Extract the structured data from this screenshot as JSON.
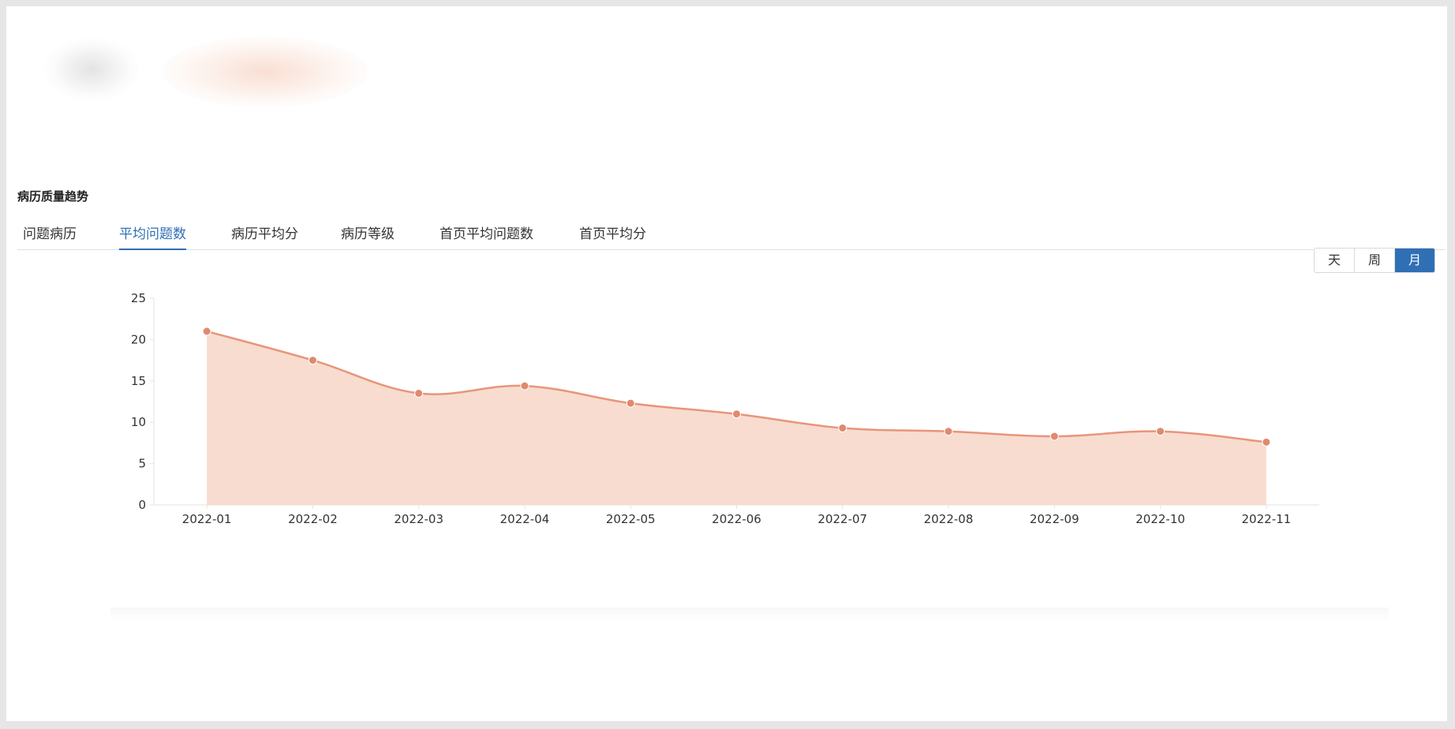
{
  "section_title": "病历质量趋势",
  "tabs": [
    {
      "label": "问题病历",
      "active": false
    },
    {
      "label": "平均问题数",
      "active": true
    },
    {
      "label": "病历平均分",
      "active": false
    },
    {
      "label": "病历等级",
      "active": false
    },
    {
      "label": "首页平均问题数",
      "active": false
    },
    {
      "label": "首页平均分",
      "active": false
    }
  ],
  "period_buttons": [
    {
      "label": "天",
      "active": false
    },
    {
      "label": "周",
      "active": false
    },
    {
      "label": "月",
      "active": true
    }
  ],
  "colors": {
    "accent": "#2f6fb4",
    "line": "#e8957a",
    "area": "#f7d6c8",
    "point": "#e08a6e"
  },
  "chart_data": {
    "type": "area",
    "categories": [
      "2022-01",
      "2022-02",
      "2022-03",
      "2022-04",
      "2022-05",
      "2022-06",
      "2022-07",
      "2022-08",
      "2022-09",
      "2022-10",
      "2022-11"
    ],
    "values": [
      21.0,
      17.5,
      13.5,
      14.4,
      12.3,
      11.0,
      9.3,
      8.9,
      8.3,
      8.9,
      7.6
    ],
    "title": "",
    "xlabel": "",
    "ylabel": "",
    "ylim": [
      0,
      25
    ],
    "yticks": [
      "0",
      "5",
      "10",
      "15",
      "20",
      "25"
    ],
    "grid": false,
    "smooth": true
  }
}
